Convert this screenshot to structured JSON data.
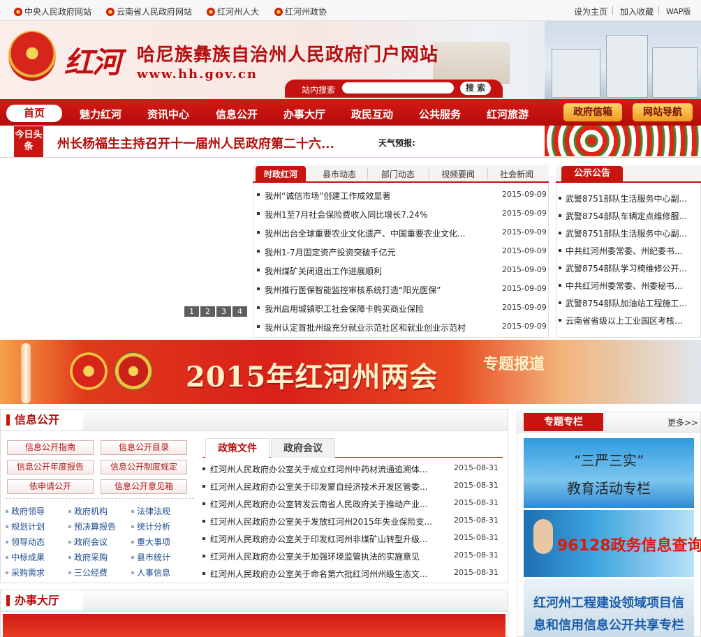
{
  "topbar": {
    "links": [
      "中央人民政府网站",
      "云南省人民政府网站",
      "红河州人大",
      "红河州政协"
    ],
    "right": [
      "设为主页",
      "加入收藏",
      "WAP版"
    ]
  },
  "header": {
    "brush_logo": "红河",
    "site_title": "哈尼族彝族自治州人民政府门户网站",
    "site_url": "www.hh.gov.cn",
    "search_label": "站内搜索",
    "search_value": "",
    "search_button": "搜 索"
  },
  "nav": {
    "home": "首页",
    "items": [
      "魅力红河",
      "资讯中心",
      "信息公开",
      "办事大厅",
      "政民互动",
      "公共服务",
      "红河旅游"
    ],
    "buttons": [
      "政府信箱",
      "网站导航"
    ]
  },
  "headline": {
    "label": "今日头条",
    "text": "州长杨福生主持召开十一届州人民政府第二十六...",
    "weather_label": "天气预报:"
  },
  "slider": {
    "pages": [
      "1",
      "2",
      "3",
      "4"
    ]
  },
  "news": {
    "tabs": [
      "时政红河",
      "县市动态",
      "部门动态",
      "视频要闻",
      "社会新闻"
    ],
    "items": [
      {
        "title": "我州“诚信市场”创建工作成效显著",
        "date": "2015-09-09"
      },
      {
        "title": "我州1至7月社会保险费收入同比增长7.24%",
        "date": "2015-09-09"
      },
      {
        "title": "我州出台全球重要农业文化遗产、中国重要农业文化...",
        "date": "2015-09-09"
      },
      {
        "title": "我州1-7月固定资产投资突破千亿元",
        "date": "2015-09-09"
      },
      {
        "title": "我州煤矿关闭退出工作进展顺利",
        "date": "2015-09-09"
      },
      {
        "title": "我州推行医保智能监控审核系统打造“阳光医保”",
        "date": "2015-09-09"
      },
      {
        "title": "我州启用城镇职工社会保障卡购买商业保险",
        "date": "2015-09-09"
      },
      {
        "title": "我州认定首批州级充分就业示范社区和就业创业示范村",
        "date": "2015-09-09"
      }
    ]
  },
  "notice": {
    "tab": "公示公告",
    "items": [
      "武警8751部队生活服务中心副...",
      "武警8754部队车辆定点维修服...",
      "武警8751部队生活服务中心副...",
      "中共红河州委常委、州纪委书...",
      "武警8754部队学习椅维修公开...",
      "中共红河州委常委、州委秘书...",
      "武警8754部队加油站工程施工...",
      "云南省省级以上工业园区考核办法"
    ]
  },
  "banner": {
    "title": "2015年红河州两会",
    "tag": "专题报道"
  },
  "info": {
    "title": "信息公开",
    "buttons": [
      "信息公开指南",
      "信息公开目录",
      "信息公开年度报告",
      "信息公开制度规定",
      "依申请公开",
      "信息公开意见箱"
    ],
    "links": [
      [
        "政府领导",
        "政府机构",
        "法律法规"
      ],
      [
        "规划计划",
        "预决算报告",
        "统计分析"
      ],
      [
        "领导动态",
        "政府会议",
        "重大事项"
      ],
      [
        "中标成果",
        "政府采购",
        "县市统计"
      ],
      [
        "采购需求",
        "三公经费",
        "人事信息"
      ]
    ],
    "tabs": [
      "政策文件",
      "政府会议"
    ],
    "items": [
      {
        "title": "红河州人民政府办公室关于成立红河州中药材流通追溯体...",
        "date": "2015-08-31"
      },
      {
        "title": "红河州人民政府办公室关于印发蒙自经济技术开发区管委...",
        "date": "2015-08-31"
      },
      {
        "title": "红河州人民政府办公室转发云南省人民政府关于推动产业...",
        "date": "2015-08-31"
      },
      {
        "title": "红河州人民政府办公室关于发放红河州2015年失业保险支...",
        "date": "2015-08-31"
      },
      {
        "title": "红河州人民政府办公室关于印发红河州非煤矿山转型升级...",
        "date": "2015-08-31"
      },
      {
        "title": "红河州人民政府办公室关于加强环境监管执法的实施意见",
        "date": "2015-08-31"
      },
      {
        "title": "红河州人民政府办公室关于命名第六批红河州州级生态文...",
        "date": "2015-08-31"
      }
    ]
  },
  "special": {
    "title": "专题专栏",
    "more": "更多>>",
    "card1_line1": "“三严三实”",
    "card1_line2": "教育活动专栏",
    "card2": "96128政务信息查询",
    "card3_line1": "红河州工程建设领域项目信",
    "card3_line2": "息和信用信息公开共享专栏"
  },
  "hall": {
    "title": "办事大厅"
  }
}
